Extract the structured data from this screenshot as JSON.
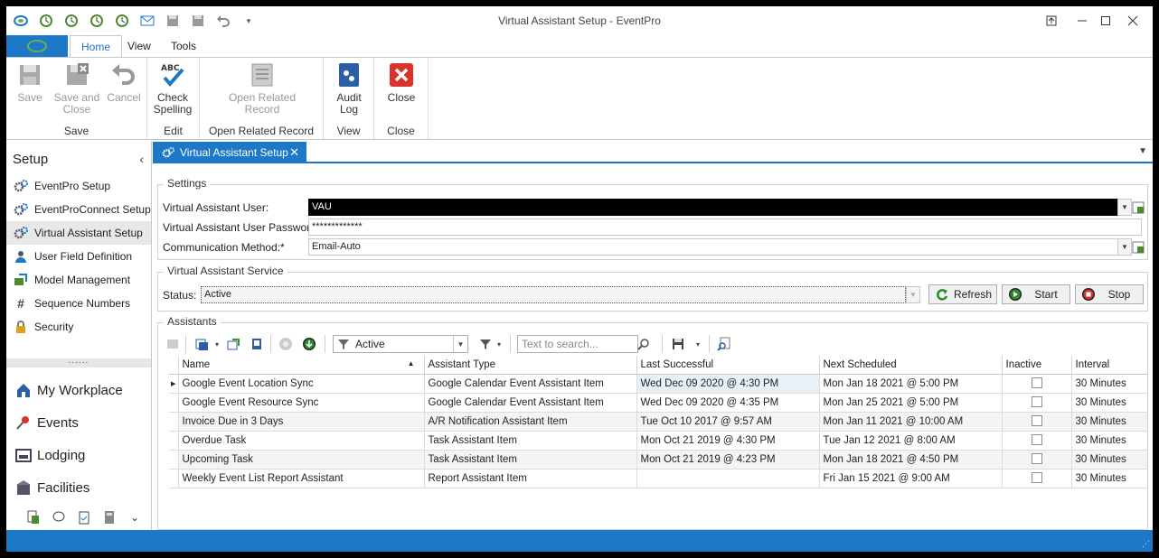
{
  "window": {
    "title": "Virtual Assistant Setup - EventPro"
  },
  "ribbon_tabs": [
    "Home",
    "View",
    "Tools"
  ],
  "ribbon": {
    "save": {
      "label": "Save",
      "buttons": {
        "save": "Save",
        "save_close_1": "Save and",
        "save_close_2": "Close",
        "cancel": "Cancel"
      }
    },
    "edit": {
      "label": "Edit",
      "check_1": "Check",
      "check_2": "Spelling"
    },
    "related": {
      "label": "Open Related Record",
      "btn_1": "Open Related",
      "btn_2": "Record"
    },
    "view": {
      "label": "View",
      "audit_1": "Audit",
      "audit_2": "Log"
    },
    "close": {
      "label": "Close",
      "btn": "Close"
    }
  },
  "nav": {
    "header": "Setup",
    "items": [
      {
        "label": "EventPro Setup",
        "icon": "gears-icon"
      },
      {
        "label": "EventProConnect Setup",
        "icon": "gears-icon"
      },
      {
        "label": "Virtual Assistant Setup",
        "icon": "gears-icon"
      },
      {
        "label": "User Field Definition",
        "icon": "user-icon"
      },
      {
        "label": "Model Management",
        "icon": "model-icon"
      },
      {
        "label": "Sequence Numbers",
        "icon": "hash-icon"
      },
      {
        "label": "Security",
        "icon": "lock-icon"
      }
    ],
    "splitter": "......",
    "big_items": [
      {
        "label": "My Workplace",
        "icon": "home-icon"
      },
      {
        "label": "Events",
        "icon": "pin-icon"
      },
      {
        "label": "Lodging",
        "icon": "bed-icon"
      },
      {
        "label": "Facilities",
        "icon": "building-icon"
      }
    ]
  },
  "doc_tab": {
    "label": "Virtual Assistant Setup",
    "close": "✕"
  },
  "settings": {
    "legend": "Settings",
    "user_label": "Virtual Assistant User:",
    "user_value": "VAU",
    "password_label": "Virtual Assistant User Password:",
    "password_value": "*************",
    "method_label": "Communication Method:*",
    "method_value": "Email-Auto"
  },
  "service": {
    "legend": "Virtual Assistant Service",
    "status_label": "Status:",
    "status_value": "Active",
    "refresh": "Refresh",
    "start": "Start",
    "stop": "Stop"
  },
  "assistants": {
    "legend": "Assistants",
    "filter_value": "Active",
    "search_placeholder": "Text to search...",
    "columns": [
      "Name",
      "Assistant Type",
      "Last Successful",
      "Next Scheduled",
      "Inactive",
      "Interval"
    ],
    "rows": [
      {
        "name": "Google Event Location Sync",
        "type": "Google Calendar Event Assistant Item",
        "last": "Wed Dec 09 2020 @ 4:30 PM",
        "next": "Mon Jan 18 2021 @ 5:00 PM",
        "inactive": false,
        "interval": "30 Minutes"
      },
      {
        "name": "Google Event Resource Sync",
        "type": "Google Calendar Event Assistant Item",
        "last": "Wed Dec 09 2020 @ 4:35 PM",
        "next": "Mon Jan 25 2021 @ 5:00 PM",
        "inactive": false,
        "interval": "30 Minutes"
      },
      {
        "name": "Invoice Due in 3 Days",
        "type": "A/R Notification Assistant Item",
        "last": "Tue Oct 10 2017 @ 9:57 AM",
        "next": "Mon Jan 11 2021 @ 10:00 AM",
        "inactive": false,
        "interval": "30 Minutes"
      },
      {
        "name": "Overdue Task",
        "type": "Task Assistant Item",
        "last": "Mon Oct 21 2019 @ 4:30 PM",
        "next": "Tue Jan 12 2021 @ 8:00 AM",
        "inactive": false,
        "interval": "30 Minutes"
      },
      {
        "name": "Upcoming Task",
        "type": "Task Assistant Item",
        "last": "Mon Oct 21 2019 @ 4:23 PM",
        "next": "Mon Jan 18 2021 @ 4:50 PM",
        "inactive": false,
        "interval": "30 Minutes"
      },
      {
        "name": "Weekly Event List Report Assistant",
        "type": "Report Assistant Item",
        "last": "",
        "next": "Fri Jan 15 2021 @ 9:00 AM",
        "inactive": false,
        "interval": "30 Minutes"
      }
    ]
  },
  "colors": {
    "accent": "#1e78c8",
    "close_red": "#d9342b",
    "start_green": "#2e8b2e"
  }
}
